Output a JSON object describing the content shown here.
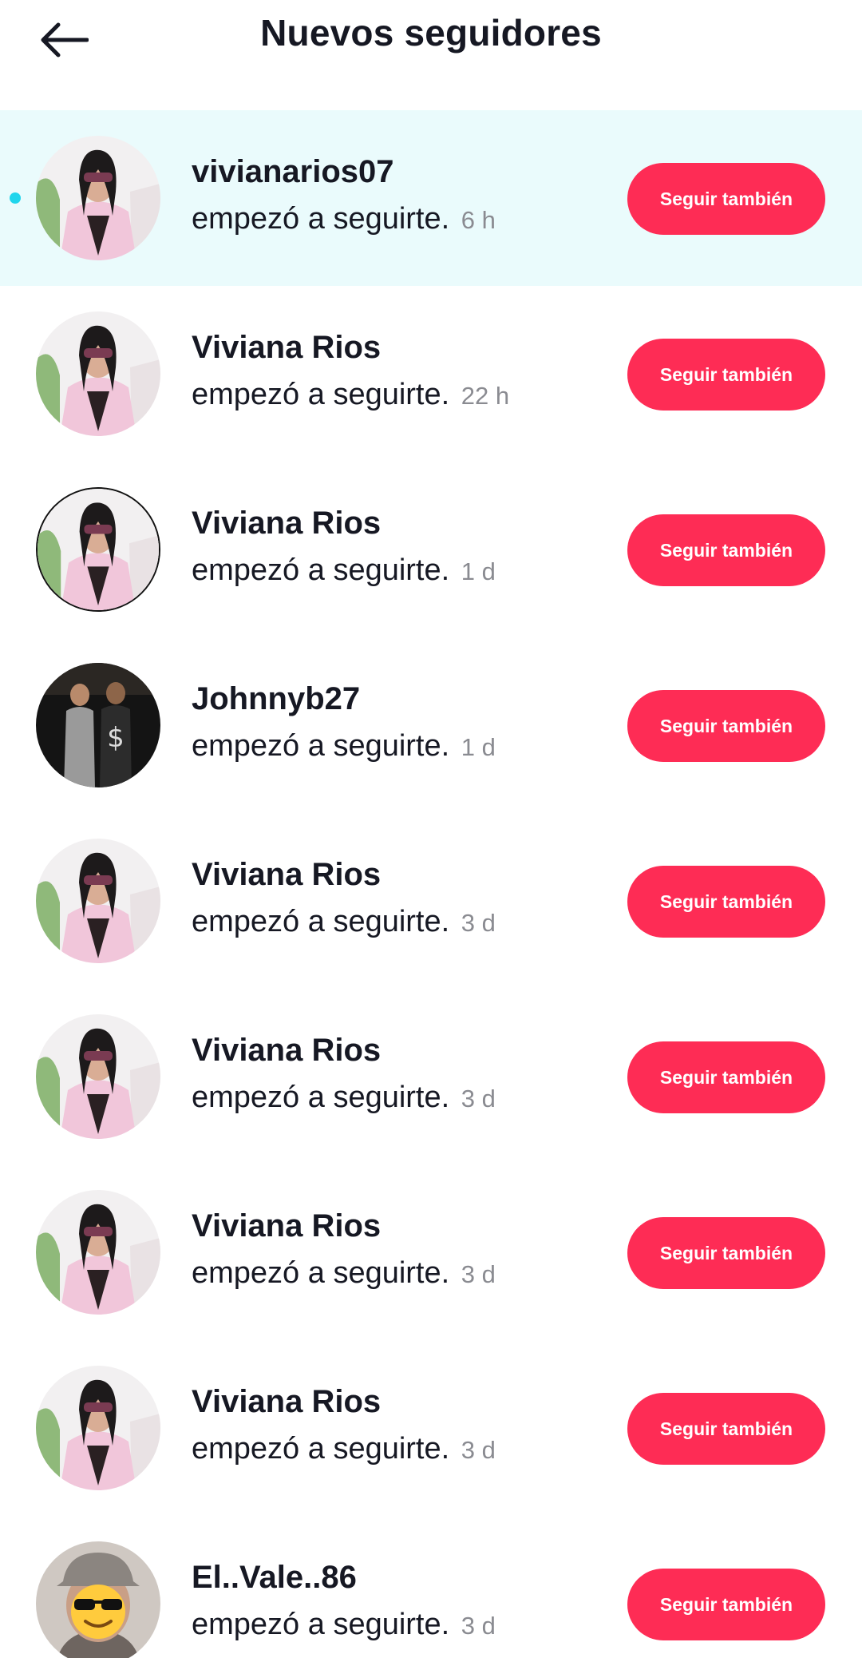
{
  "header": {
    "title": "Nuevos seguidores",
    "back_icon": "arrow-left-icon"
  },
  "colors": {
    "accent": "#fe2c55",
    "unread_bg": "#eafbfc",
    "unread_dot": "#20d5ec",
    "muted_text": "#8a8b91"
  },
  "followers": [
    {
      "name": "vivianarios07",
      "action": "empezó a seguirte.",
      "time": "6 h",
      "button": "Seguir también",
      "unread": true
    },
    {
      "name": "Viviana Rios",
      "action": "empezó a seguirte.",
      "time": "22 h",
      "button": "Seguir también"
    },
    {
      "name": "Viviana Rios",
      "action": "empezó a seguirte.",
      "time": "1 d",
      "button": "Seguir también"
    },
    {
      "name": "Johnnyb27",
      "action": "empezó a seguirte.",
      "time": "1 d",
      "button": "Seguir también"
    },
    {
      "name": "Viviana Rios",
      "action": "empezó a seguirte.",
      "time": "3 d",
      "button": "Seguir también"
    },
    {
      "name": "Viviana Rios",
      "action": "empezó a seguirte.",
      "time": "3 d",
      "button": "Seguir también"
    },
    {
      "name": "Viviana Rios",
      "action": "empezó a seguirte.",
      "time": "3 d",
      "button": "Seguir también"
    },
    {
      "name": "Viviana Rios",
      "action": "empezó a seguirte.",
      "time": "3 d",
      "button": "Seguir también"
    },
    {
      "name": "El..Vale..86",
      "action": "empezó a seguirte.",
      "time": "3 d",
      "button": "Seguir también"
    }
  ]
}
